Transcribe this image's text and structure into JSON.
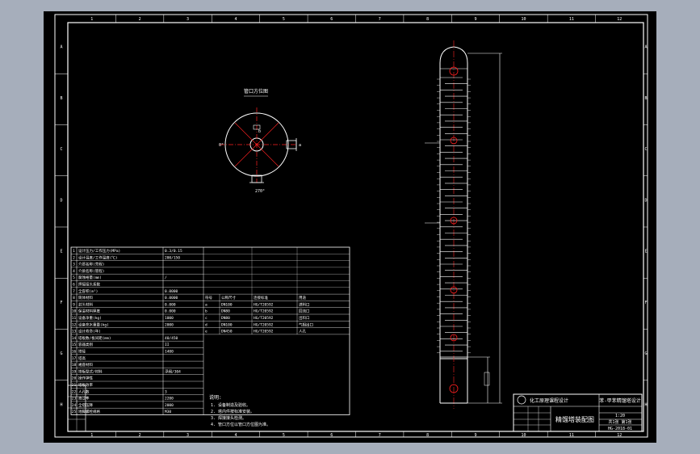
{
  "drawing": {
    "background": "#000000",
    "line_color": "#ffffff",
    "accent_color": "#ff2020",
    "grid_cols": [
      "1",
      "2",
      "3",
      "4",
      "5",
      "6",
      "7",
      "8",
      "9",
      "10",
      "11",
      "12"
    ],
    "grid_rows": [
      "A",
      "B",
      "C",
      "D",
      "E",
      "F",
      "G",
      "H"
    ],
    "section_label": "管口方位图",
    "notes_title": "说明:",
    "notes": [
      "1. 设备制造及验收。",
      "2. 塔内件按标准安装。",
      "3. 焊接接头检测。",
      "4. 管口方位以管口方位图为准。"
    ]
  },
  "tech_table": [
    [
      "1",
      "设计压力/工作压力(MPa)",
      "0.3/0.15"
    ],
    [
      "2",
      "设计温度/工作温度(℃)",
      "200/150"
    ],
    [
      "3",
      "介质名称(壳程)",
      ""
    ],
    [
      "4",
      "介质名称(管程)",
      ""
    ],
    [
      "5",
      "腐蚀裕量(mm)",
      "/"
    ],
    [
      "6",
      "焊接接头系数",
      ""
    ],
    [
      "7",
      "全容积(m³)",
      "0.0000"
    ],
    [
      "8",
      "筒体材料",
      "0.0000"
    ],
    [
      "9",
      "封头材料",
      "0.000"
    ],
    [
      "10",
      "保温材料厚度",
      "0.000"
    ],
    [
      "11",
      "设备净重(kg)",
      "1000"
    ],
    [
      "12",
      "设备充水重量(kg)",
      "2000"
    ],
    [
      "13",
      "设计寿命(年)",
      ""
    ],
    [
      "14",
      "塔板数/板间距(mm)",
      "40/450"
    ],
    [
      "15",
      "容器类别",
      "II"
    ],
    [
      "16",
      "塔径",
      "1400"
    ],
    [
      "17",
      "塔高",
      ""
    ],
    [
      "18",
      "裙座材料",
      ""
    ],
    [
      "19",
      "塔板型式/材料",
      "浮阀/304"
    ],
    [
      "20",
      "操作弹性",
      ""
    ],
    [
      "21",
      "塔板效率",
      ""
    ],
    [
      "22",
      "人孔数",
      "3"
    ],
    [
      "23",
      "液泛率",
      "2200"
    ],
    [
      "24",
      "全塔压降",
      "2000"
    ],
    [
      "25",
      "地脚螺栓规格",
      "M30"
    ]
  ],
  "nozzle_table": {
    "headers": [
      "符号",
      "公称尺寸",
      "连接标准",
      "用途"
    ],
    "rows": [
      [
        "a",
        "DN100",
        "HG/T20592",
        "进料口"
      ],
      [
        "b",
        "DN80",
        "HG/T20592",
        "回流口"
      ],
      [
        "c",
        "DN80",
        "HG/T20592",
        "出料口"
      ],
      [
        "d",
        "DN100",
        "HG/T20592",
        "气相出口"
      ],
      [
        "e",
        "DN450",
        "HG/T20592",
        "人孔"
      ]
    ]
  },
  "title_block": {
    "school": "化工原理课程设计",
    "drawing_name": "精馏塔装配图",
    "project": "苯-甲苯精馏塔设计",
    "scale": "1:20",
    "sheet": "共1张 第1张",
    "drawing_no": "HG-2018-01"
  }
}
